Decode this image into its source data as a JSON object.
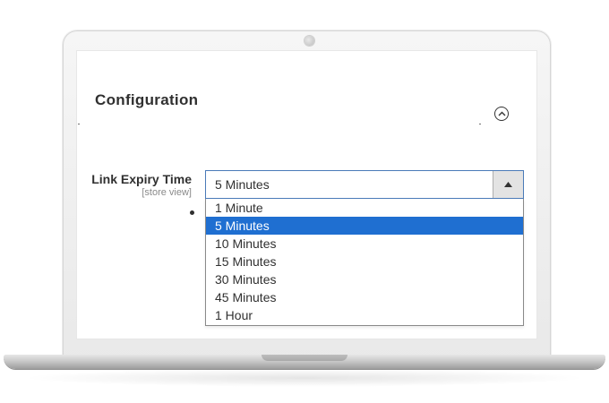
{
  "section": {
    "title": "Configuration",
    "collapse_icon": "chevron-up-circle-icon"
  },
  "field": {
    "label": "Link Expiry Time",
    "scope": "[store view]"
  },
  "select": {
    "value": "5 Minutes",
    "arrow_icon": "triangle-up-icon",
    "expanded": true,
    "selected_index": 1,
    "options": [
      "1 Minute",
      "5 Minutes",
      "10 Minutes",
      "15 Minutes",
      "30 Minutes",
      "45 Minutes",
      "1 Hour"
    ]
  },
  "colors": {
    "selected_option_bg": "#1f6fd1",
    "select_border": "#4a7ab8",
    "text": "#303030"
  }
}
